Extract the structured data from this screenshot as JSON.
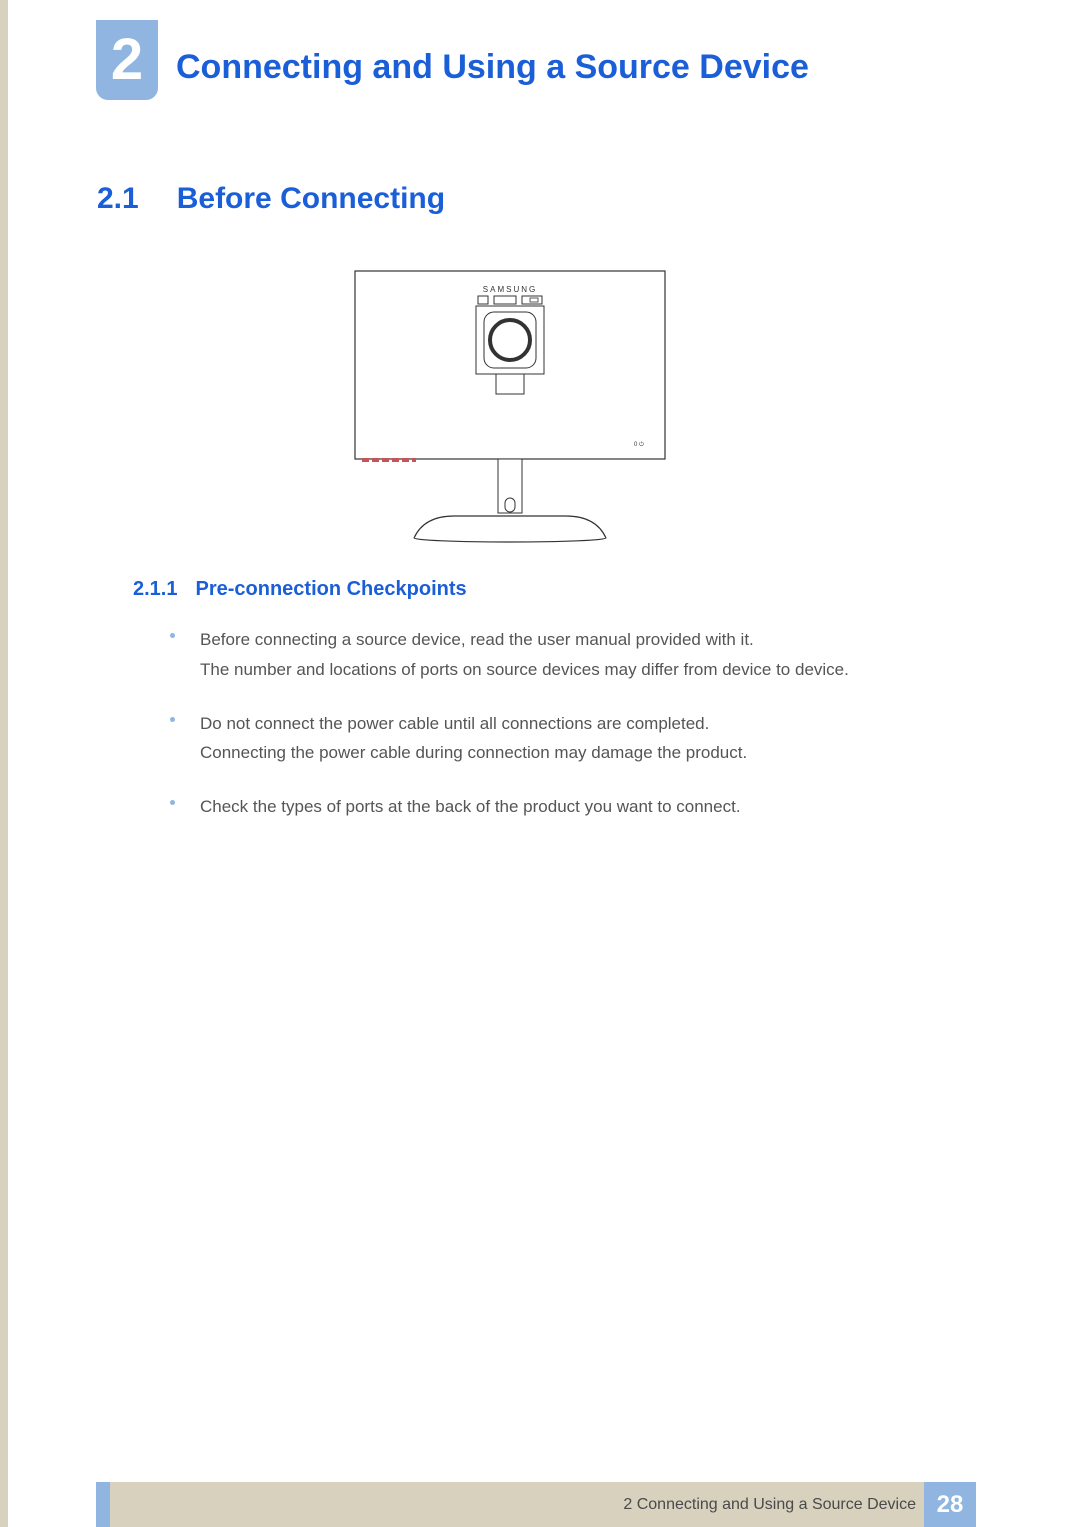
{
  "chapter": {
    "number": "2",
    "title": "Connecting and Using a Source Device"
  },
  "section": {
    "number": "2.1",
    "title": "Before Connecting"
  },
  "figure": {
    "brand": "SAMSUNG"
  },
  "subsection": {
    "number": "2.1.1",
    "title": "Pre-connection Checkpoints"
  },
  "bullets": [
    {
      "line1": "Before connecting a source device, read the user manual provided with it.",
      "line2": "The number and locations of ports on source devices may differ from device to device."
    },
    {
      "line1": "Do not connect the power cable until all connections are completed.",
      "line2": "Connecting the power cable during connection may damage the product."
    },
    {
      "line1": "Check the types of ports at the back of the product you want to connect.",
      "line2": ""
    }
  ],
  "footer": {
    "text": "2 Connecting and Using a Source Device",
    "page": "28"
  }
}
